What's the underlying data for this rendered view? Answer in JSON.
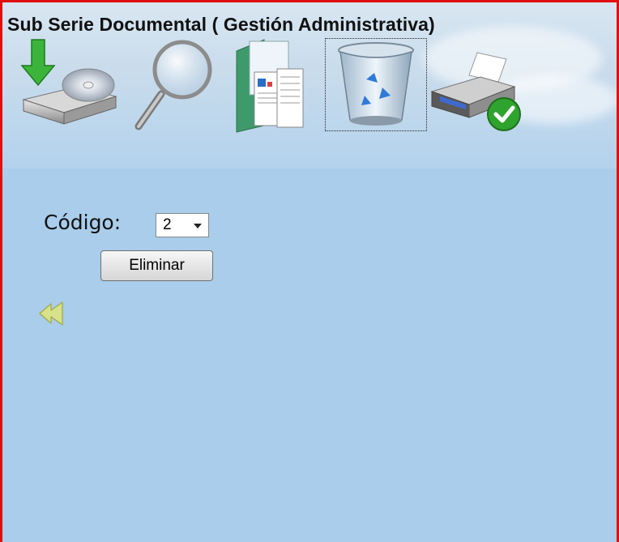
{
  "header": {
    "title": "Sub Serie Documental ( Gestión Administrativa)"
  },
  "toolbar": {
    "items": [
      {
        "icon": "save-disk-icon",
        "selected": false
      },
      {
        "icon": "search-magnifier-icon",
        "selected": false
      },
      {
        "icon": "report-documents-icon",
        "selected": false
      },
      {
        "icon": "recycle-bin-icon",
        "selected": true
      },
      {
        "icon": "printer-check-icon",
        "selected": false
      }
    ]
  },
  "form": {
    "codigo_label": "Código:",
    "codigo_value": "2",
    "delete_button": "Eliminar"
  },
  "nav": {
    "back_icon": "double-left-arrow-icon"
  },
  "colors": {
    "frame_border": "#e01010",
    "background": "#a9cdea",
    "back_arrow": "#d8e28a"
  }
}
